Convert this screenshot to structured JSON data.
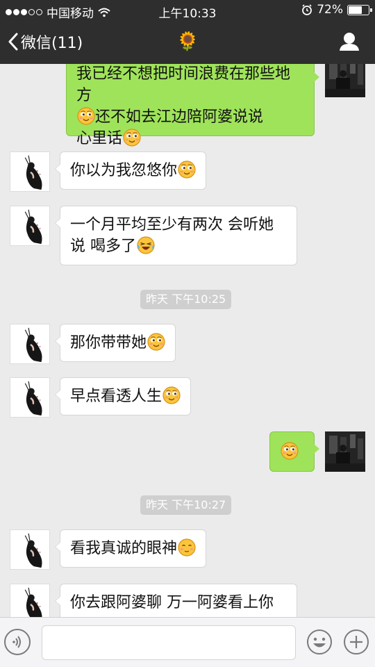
{
  "status_bar": {
    "carrier": "中国移动",
    "time": "上午10:33",
    "battery": "72%",
    "battery_level": 0.72
  },
  "nav": {
    "back_label": "微信(11)",
    "title_glyph": "🌻"
  },
  "messages": [
    {
      "text": "我已经不想把时间浪费在那些地方",
      "line2": "还不如去江边陪阿婆说说",
      "line3": "心里话"
    },
    {
      "text": "你以为我忽悠你"
    },
    {
      "text": "一个月平均至少有两次 会听她",
      "line2": "说 喝多了"
    },
    {
      "text": "那你带带她"
    },
    {
      "text": "早点看透人生"
    },
    {
      "text": "看我真诚的眼神"
    },
    {
      "text": "你去跟阿婆聊 万一阿婆看上你"
    }
  ],
  "timestamps": [
    "昨天 下午10:25",
    "昨天 下午10:27"
  ],
  "icons": {
    "back": "chevron-left-icon",
    "profile": "person-icon",
    "voice": "voice-icon",
    "emoji": "smiley-icon",
    "plus": "plus-icon"
  },
  "colors": {
    "nav_bg": "#2e2e2e",
    "chat_bg": "#ebebeb",
    "outgoing_bubble": "#9fe35a",
    "incoming_bubble": "#ffffff",
    "timestamp_bg": "#cfcfcf"
  }
}
